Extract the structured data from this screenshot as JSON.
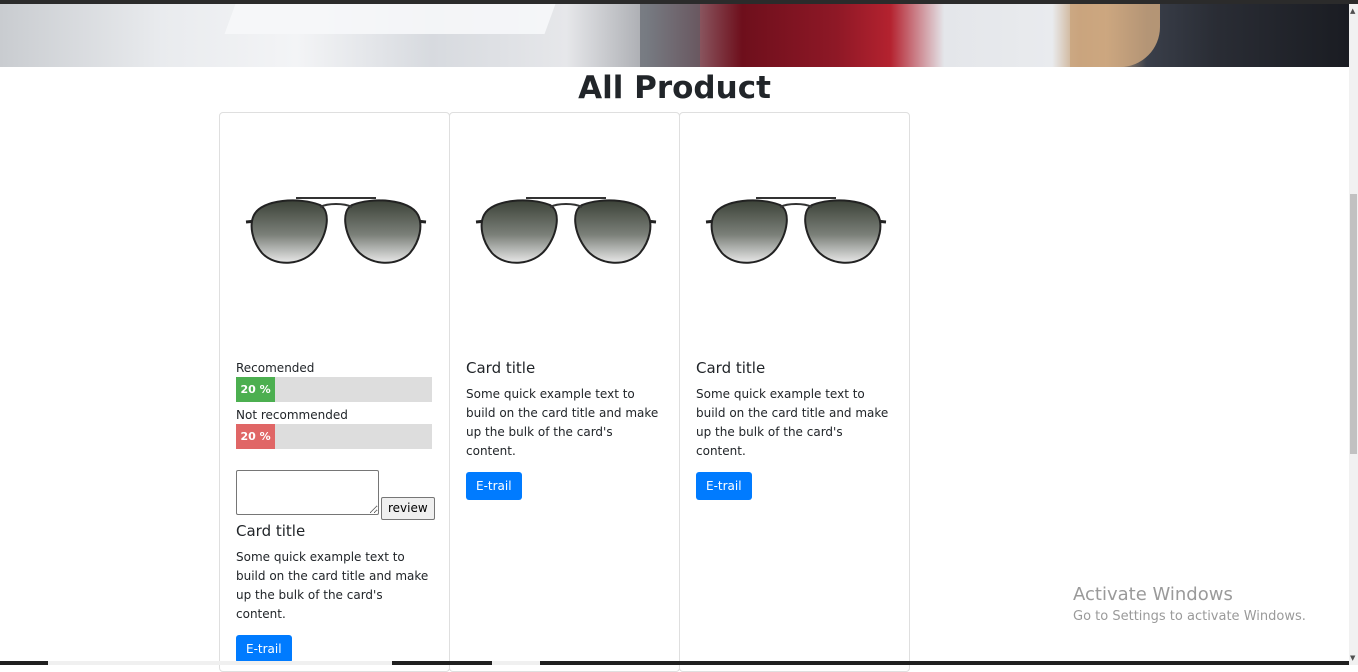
{
  "page": {
    "title": "All Product"
  },
  "cards": [
    {
      "title": "Card title",
      "text": "Some quick example text to build on the card title and make up the bulk of the card's content.",
      "button": "E-trail",
      "rating": {
        "recommended_label": "Recomended",
        "recommended_value": "20 %",
        "recommended_fraction": 0.2,
        "not_recommended_label": "Not recommended",
        "not_recommended_value": "20 %",
        "not_recommended_fraction": 0.2
      },
      "review_button": "review"
    },
    {
      "title": "Card title",
      "text": "Some quick example text to build on the card title and make up the bulk of the card's content.",
      "button": "E-trail"
    },
    {
      "title": "Card title",
      "text": "Some quick example text to build on the card title and make up the bulk of the card's content.",
      "button": "E-trail"
    }
  ],
  "colors": {
    "primary_button": "#007bff",
    "recommended_bar": "#4caf50",
    "not_recommended_bar": "#e06666"
  },
  "watermark": {
    "line1": "Activate Windows",
    "line2": "Go to Settings to activate Windows."
  }
}
